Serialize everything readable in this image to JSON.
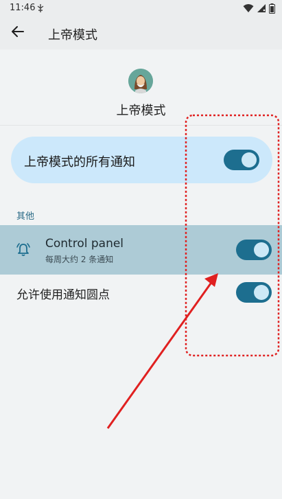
{
  "status_bar": {
    "time": "11:46"
  },
  "app_bar": {
    "title": "上帝模式"
  },
  "app_header": {
    "name": "上帝模式",
    "icon": "app-avatar-icon"
  },
  "master_switch": {
    "label": "上帝模式的所有通知",
    "on": true
  },
  "section": {
    "title": "其他"
  },
  "channel": {
    "title": "Control panel",
    "subtitle": "每周大约 2 条通知",
    "icon": "bell-icon",
    "on": true
  },
  "dot_setting": {
    "label": "允许使用通知圆点",
    "on": true
  },
  "colors": {
    "accent": "#1d6e8f",
    "card": "#cce8fb",
    "highlight_row": "#adcbd6",
    "annotation": "#e02020"
  }
}
